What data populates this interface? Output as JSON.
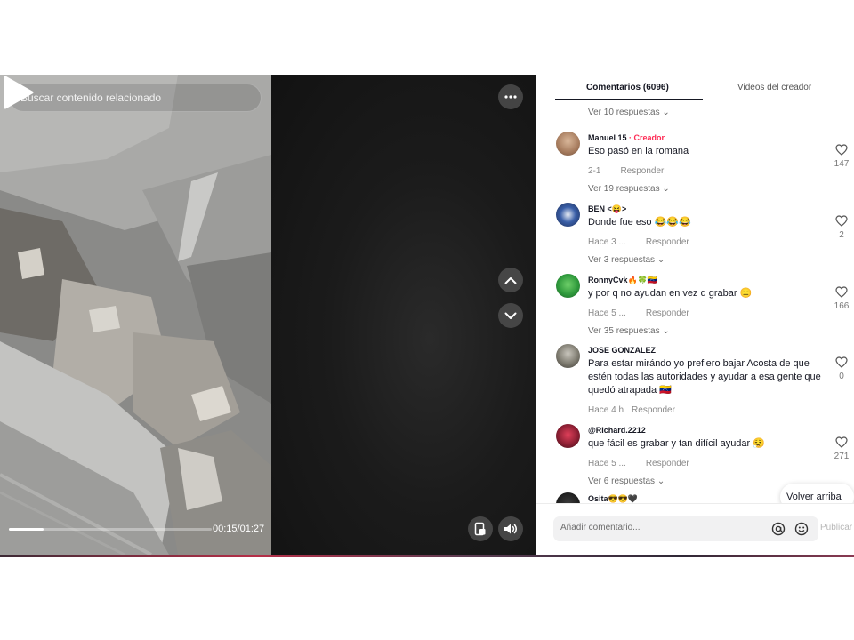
{
  "search": {
    "placeholder": "Buscar contenido relacionado"
  },
  "player": {
    "time": "00:15/01:27",
    "progress": 0.17
  },
  "tabs": {
    "comments": "Comentarios (6096)",
    "videos": "Videos del creador"
  },
  "top_replies_link": "Ver 10 respuestas",
  "comments": [
    {
      "user": "Manuel 15",
      "creator_badge": "· Creador",
      "text": "Eso pasó en la romana",
      "time": "2-1",
      "reply": "Responder",
      "likes": "147",
      "replies": "Ver 19 respuestas"
    },
    {
      "user": "BEN <😝>",
      "text": "Donde fue eso 😂😂😂",
      "time": "Hace 3 ...",
      "reply": "Responder",
      "likes": "2",
      "replies": "Ver 3 respuestas"
    },
    {
      "user": "RonnyCvk🔥🍀🇻🇪",
      "text": "y por q no ayudan en vez d grabar 😑",
      "time": "Hace 5 ...",
      "reply": "Responder",
      "likes": "166",
      "replies": "Ver 35 respuestas"
    },
    {
      "user": "JOSE GONZALEZ",
      "text": "Para estar mirándo yo prefiero bajar Acosta de que estén todas las autoridades y ayudar a esa gente que quedó atrapada 🇻🇪",
      "time": "Hace 4 h",
      "reply": "Responder",
      "likes": "0"
    },
    {
      "user": "@Richard.2212",
      "text": "que fácil es grabar y tan difícil ayudar 😮‍💨",
      "time": "Hace 5 ...",
      "reply": "Responder",
      "likes": "271",
      "replies": "Ver 6 respuestas"
    },
    {
      "user": "Osita😎😎🖤"
    }
  ],
  "back_to_top": "Volver arriba",
  "input": {
    "placeholder": "Añadir comentario...",
    "publish": "Publicar"
  }
}
